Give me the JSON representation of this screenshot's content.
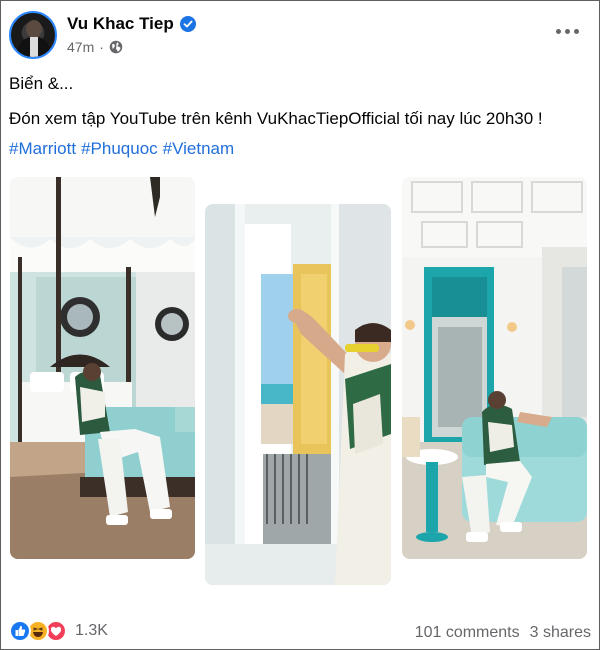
{
  "post": {
    "author_name": "Vu Khac Tiep",
    "timestamp": "47m",
    "separator": "·",
    "privacy_icon": "globe-icon",
    "verified_icon": "verified-badge-icon",
    "line1": "Biển &...",
    "line2": "Đón xem tập YouTube trên kênh VuKhacTiepOfficial tối nay lúc 20h30 !",
    "hashtags": [
      "#Marriott",
      "#Phuquoc",
      "#Vietnam"
    ],
    "photos": [
      {
        "name": "photo-bedroom",
        "icon": "image"
      },
      {
        "name": "photo-window",
        "icon": "image"
      },
      {
        "name": "photo-living-room",
        "icon": "image"
      }
    ]
  },
  "footer": {
    "reaction_icons": [
      "like-icon",
      "haha-icon",
      "love-icon"
    ],
    "reaction_count": "1.3K",
    "comments": "101 comments",
    "shares": "3 shares"
  },
  "colors": {
    "link_blue": "#216fdb",
    "verified_blue": "#1b74e4",
    "secondary_text": "#65676b",
    "like_blue": "#1877f2",
    "haha_yellow": "#f7b125",
    "love_red": "#f33e58"
  }
}
